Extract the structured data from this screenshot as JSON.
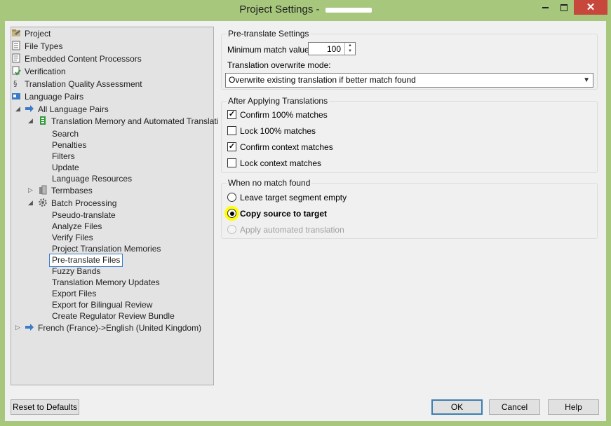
{
  "window": {
    "title": "Project Settings - ",
    "close_glyph": "✕"
  },
  "nav_tree": {
    "items": [
      {
        "label": "Project",
        "icon": "project-icon"
      },
      {
        "label": "File Types",
        "icon": "file-types-icon"
      },
      {
        "label": "Embedded Content Processors",
        "icon": "document-icon"
      },
      {
        "label": "Verification",
        "icon": "verification-icon"
      },
      {
        "label": "Translation Quality Assessment",
        "icon": "tqa-icon"
      },
      {
        "label": "Language Pairs",
        "icon": "language-pairs-icon"
      },
      {
        "label": "All Language Pairs",
        "icon": "arrow-right-icon"
      },
      {
        "label": "Translation Memory and Automated Translati",
        "icon": "tm-icon"
      },
      {
        "label": "Search"
      },
      {
        "label": "Penalties"
      },
      {
        "label": "Filters"
      },
      {
        "label": "Update"
      },
      {
        "label": "Language Resources"
      },
      {
        "label": "Termbases",
        "icon": "termbase-icon"
      },
      {
        "label": "Batch Processing",
        "icon": "gear-icon"
      },
      {
        "label": "Pseudo-translate"
      },
      {
        "label": "Analyze Files"
      },
      {
        "label": "Verify Files"
      },
      {
        "label": "Project Translation Memories"
      },
      {
        "label": "Pre-translate Files",
        "selected": true
      },
      {
        "label": "Fuzzy Bands"
      },
      {
        "label": "Translation Memory Updates"
      },
      {
        "label": "Export Files"
      },
      {
        "label": "Export for Bilingual Review"
      },
      {
        "label": "Create Regulator Review Bundle"
      },
      {
        "label": "French (France)->English (United Kingdom)",
        "icon": "arrow-right-icon"
      }
    ]
  },
  "pretranslate": {
    "title": "Pre-translate Settings",
    "min_match_label": "Minimum match value:",
    "min_match_value": "100",
    "overwrite_label": "Translation overwrite mode:",
    "overwrite_value": "Overwrite existing translation if better match found"
  },
  "after_applying": {
    "title": "After Applying Translations",
    "options": [
      {
        "label": "Confirm 100% matches",
        "checked": true
      },
      {
        "label": "Lock 100% matches",
        "checked": false
      },
      {
        "label": "Confirm context matches",
        "checked": true
      },
      {
        "label": "Lock context matches",
        "checked": false
      }
    ]
  },
  "no_match": {
    "title": "When no match found",
    "options": [
      {
        "label": "Leave target segment empty",
        "selected": false,
        "enabled": true
      },
      {
        "label": "Copy source to target",
        "selected": true,
        "enabled": true
      },
      {
        "label": "Apply automated translation",
        "selected": false,
        "enabled": false
      }
    ]
  },
  "buttons": {
    "reset": "Reset to Defaults",
    "ok": "OK",
    "cancel": "Cancel",
    "help": "Help"
  },
  "colors": {
    "titlebar": "#a6c77c",
    "close": "#c7473c",
    "highlight": "#ffff00",
    "selection_border": "#3b7bc9"
  }
}
